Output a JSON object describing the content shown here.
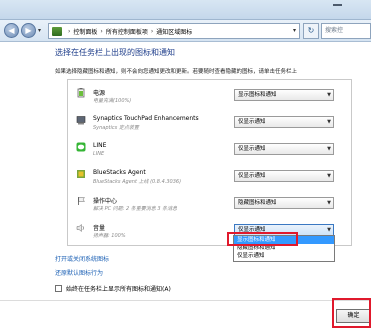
{
  "addressbar": {
    "crumbs": [
      "控制面板",
      "所有控制面板项",
      "通知区域图标"
    ],
    "search_placeholder": "搜索控"
  },
  "heading": "选择在任务栏上出现的图标和通知",
  "description": "如果选择隐藏图标和通知，则不会向您通知更改和更新。若要随时查看隐藏的图标，请单击任务栏上",
  "rows": [
    {
      "name": "电源",
      "sub": "电量充满(100%)",
      "behavior": "显示图标和通知"
    },
    {
      "name": "Synaptics TouchPad Enhancements",
      "sub": "Synaptics 定点装置",
      "behavior": "仅显示通知"
    },
    {
      "name": "LINE",
      "sub": "LINE",
      "behavior": "仅显示通知"
    },
    {
      "name": "BlueStacks Agent",
      "sub": "BlueStacks Agent 上线 (0.8.4.3036)",
      "behavior": "仅显示通知"
    },
    {
      "name": "操作中心",
      "sub": "解决 PC 问题: 2 条重要消息 3 条消息",
      "behavior": "隐藏图标和通知"
    },
    {
      "name": "音量",
      "sub": "扬声器: 100%",
      "behavior": "仅显示通知"
    }
  ],
  "dropdown": {
    "options": [
      "显示图标和通知",
      "隐藏图标和通知",
      "仅显示通知"
    ],
    "selected_index": 0
  },
  "links": {
    "system_icons": "打开或关闭系统图标",
    "restore": "还原默认图标行为"
  },
  "checkbox": {
    "label": "始终在任务栏上显示所有图标和通知(A)",
    "checked": false
  },
  "ok_label": "确定",
  "colors": {
    "heading": "#1f3e8b",
    "link": "#1a5fb4",
    "highlight": "#e0192c",
    "selected": "#3399ff"
  }
}
